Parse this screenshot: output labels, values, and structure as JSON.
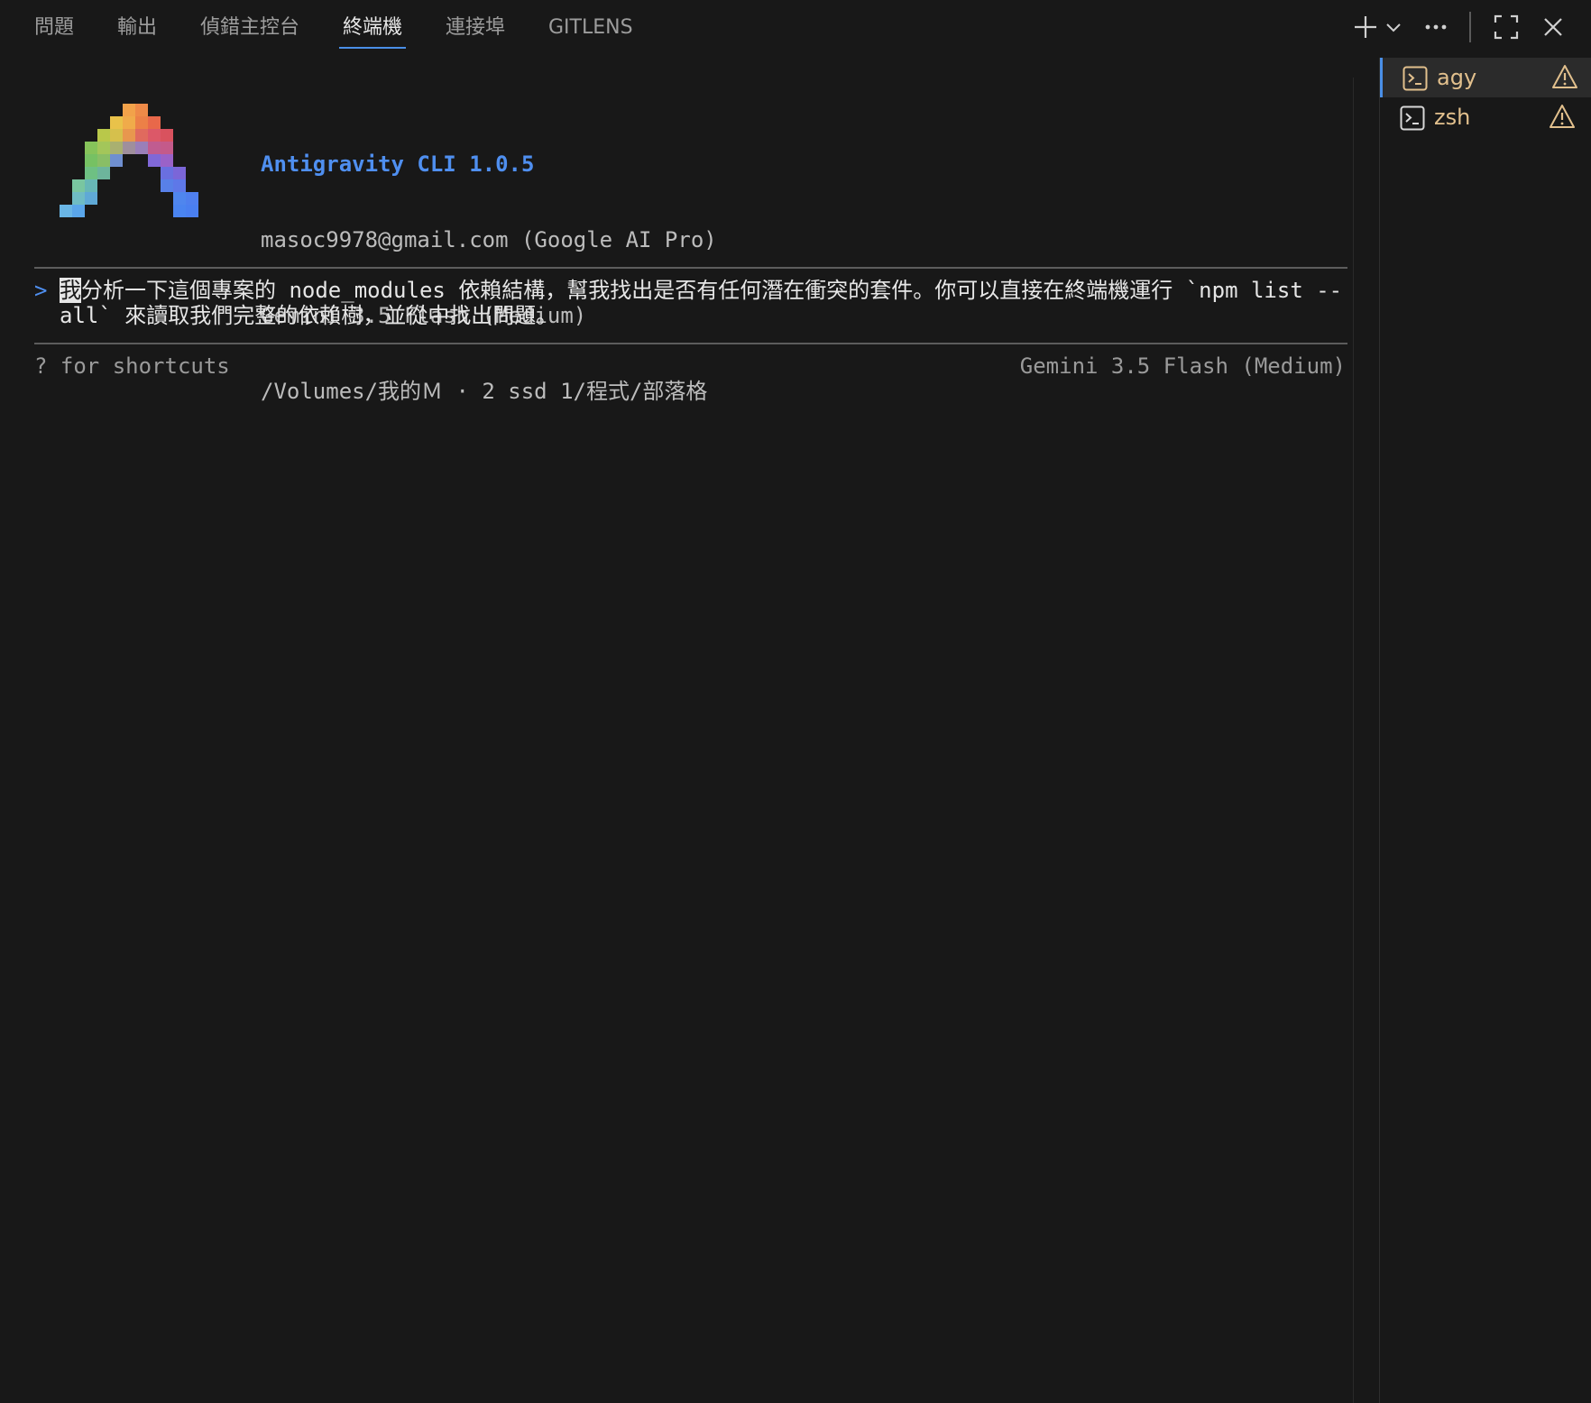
{
  "tabs": [
    {
      "label": "問題",
      "active": false
    },
    {
      "label": "輸出",
      "active": false
    },
    {
      "label": "偵錯主控台",
      "active": false
    },
    {
      "label": "終端機",
      "active": true
    },
    {
      "label": "連接埠",
      "active": false
    },
    {
      "label": "GITLENS",
      "active": false
    }
  ],
  "toolbar": {
    "icons": [
      "add-icon",
      "chevron-down-icon",
      "more-icon",
      "maximize-icon",
      "close-icon"
    ]
  },
  "header": {
    "title": "Antigravity CLI 1.0.5",
    "account": "masoc9978@gmail.com (Google AI Pro)",
    "model": "Gemini 3.5 Flash (Medium)",
    "path": "/Volumes/我的Ｍ · 2 ssd 1/程式/部落格"
  },
  "prompt": {
    "marker": ">",
    "cursor_char": "我",
    "text": "分析一下這個專案的 node_modules 依賴結構，幫我找出是否有任何潛在衝突的套件。你可以直接在終端機運行 `npm list --all` 來讀取我們完整的依賴樹，並從中找出問題。"
  },
  "status": {
    "left": "? for shortcuts",
    "right": "Gemini 3.5 Flash (Medium)"
  },
  "terminals": [
    {
      "label": "agy",
      "active": true,
      "icon": "terminal-icon",
      "status_icon": "warning-icon"
    },
    {
      "label": "zsh",
      "active": false,
      "icon": "terminal-icon",
      "status_icon": "warning-icon"
    }
  ],
  "colors": {
    "background": "#181818",
    "accent": "#4a8fe7",
    "title": "#4f8ff0",
    "warning": "#e2c08d"
  }
}
